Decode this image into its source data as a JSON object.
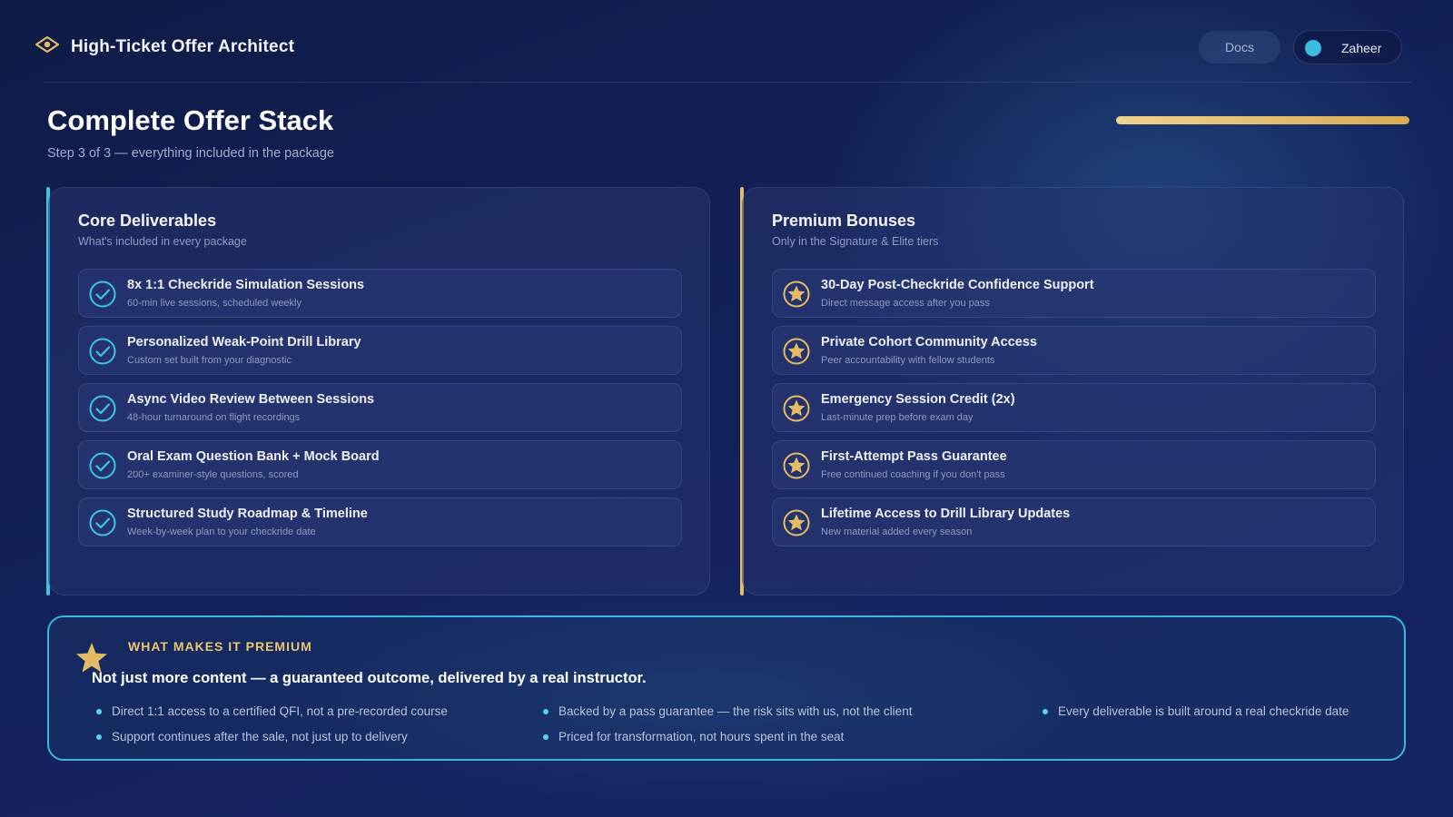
{
  "header": {
    "brand_title": "High-Ticket Offer Architect",
    "docs_label": "Docs",
    "user_name": "Zaheer"
  },
  "page": {
    "title": "Complete Offer Stack",
    "subtitle": "Step 3 of 3 — everything included in the package",
    "progress_fraction": 1.0
  },
  "colors": {
    "core_accent": "#3cc4e8",
    "bonus_accent": "#e3bb64"
  },
  "core": {
    "title": "Core Deliverables",
    "subtitle": "What's included in every package",
    "icon": "check-circle-icon",
    "items": [
      {
        "title": "8x 1:1 Checkride Simulation Sessions",
        "desc": "60-min live sessions, scheduled weekly"
      },
      {
        "title": "Personalized Weak-Point Drill Library",
        "desc": "Custom set built from your diagnostic"
      },
      {
        "title": "Async Video Review Between Sessions",
        "desc": "48-hour turnaround on flight recordings"
      },
      {
        "title": "Oral Exam Question Bank + Mock Board",
        "desc": "200+ examiner-style questions, scored"
      },
      {
        "title": "Structured Study Roadmap & Timeline",
        "desc": "Week-by-week plan to your checkride date"
      }
    ]
  },
  "bonuses": {
    "title": "Premium Bonuses",
    "subtitle": "Only in the Signature & Elite tiers",
    "icon": "star-circle-icon",
    "items": [
      {
        "title": "30-Day Post-Checkride Confidence Support",
        "desc": "Direct message access after you pass"
      },
      {
        "title": "Private Cohort Community Access",
        "desc": "Peer accountability with fellow students"
      },
      {
        "title": "Emergency Session Credit (2x)",
        "desc": "Last-minute prep before exam day"
      },
      {
        "title": "First-Attempt Pass Guarantee",
        "desc": "Free continued coaching if you don't pass"
      },
      {
        "title": "Lifetime Access to Drill Library Updates",
        "desc": "New material added every season"
      }
    ]
  },
  "premium": {
    "eyebrow": "WHAT MAKES IT PREMIUM",
    "headline": "Not just more content — a guaranteed outcome, delivered by a real instructor.",
    "bullets": [
      "Direct 1:1 access to a certified QFI, not a pre-recorded course",
      "Backed by a pass guarantee — the risk sits with us, not the client",
      "Every deliverable is built around a real checkride date",
      "Support continues after the sale, not just up to delivery",
      "Priced for transformation, not hours spent in the seat"
    ]
  }
}
